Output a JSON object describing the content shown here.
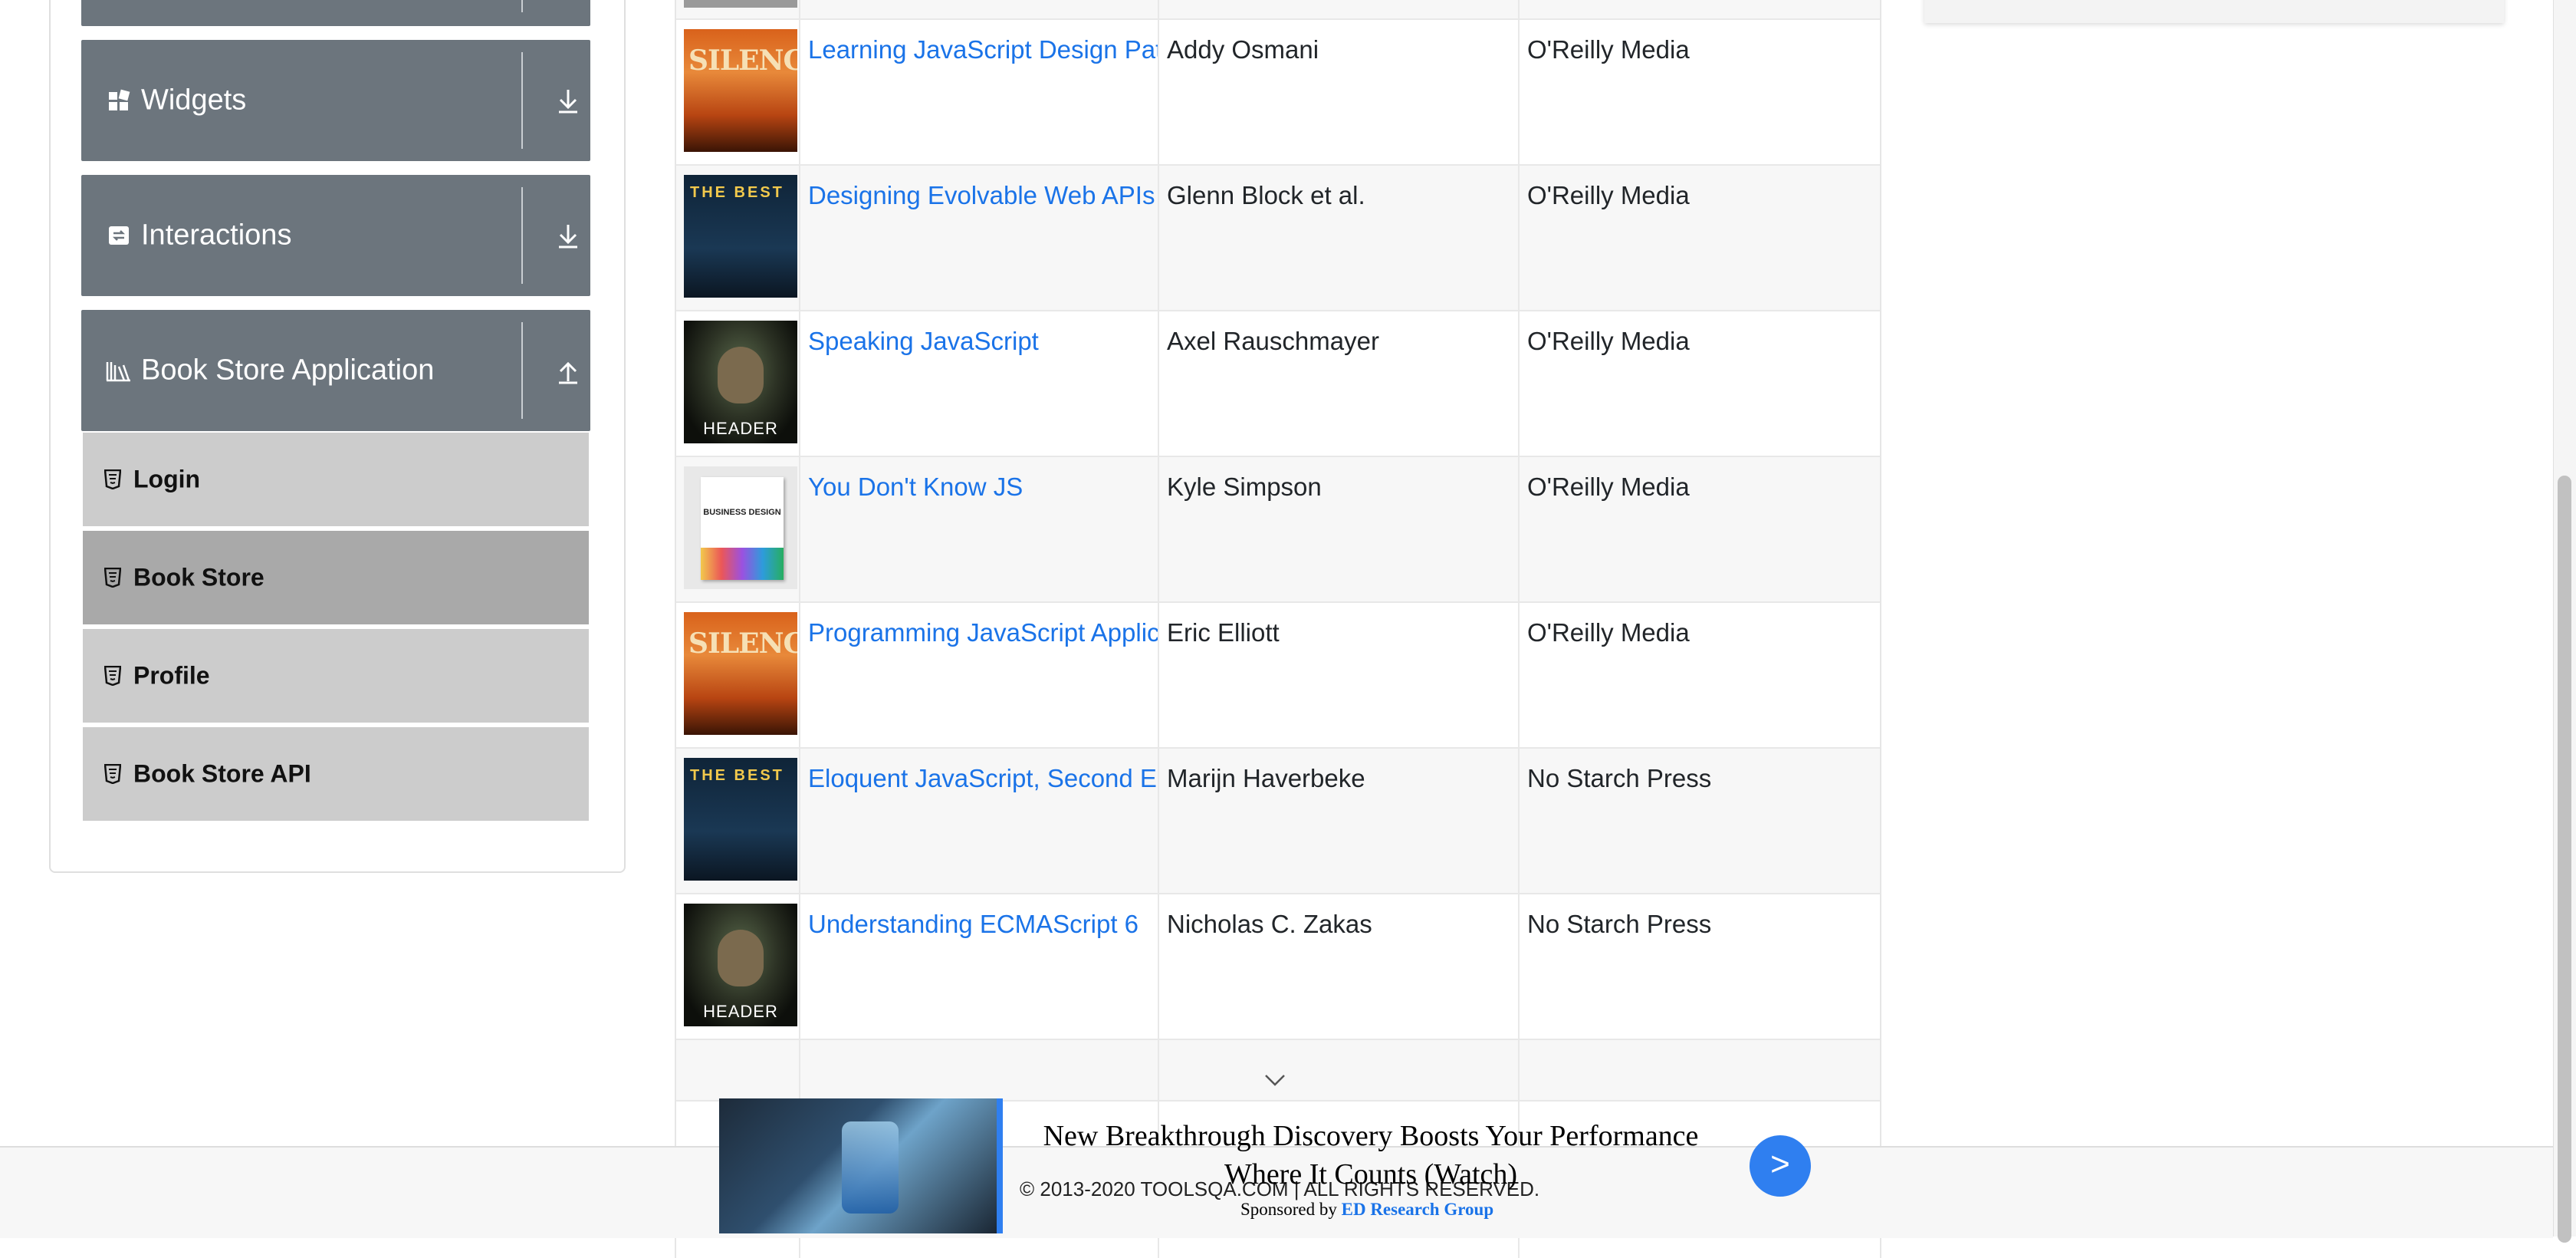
{
  "sidebar": {
    "groups": [
      {
        "label": "Widgets",
        "icon": "widgets-grid-icon",
        "arrow": "download-arrow-icon"
      },
      {
        "label": "Interactions",
        "icon": "interactions-icon",
        "arrow": "download-arrow-icon"
      },
      {
        "label": "Book Store Application",
        "icon": "library-books-icon",
        "arrow": "upload-arrow-icon"
      }
    ],
    "items": [
      {
        "label": "Login",
        "active": false
      },
      {
        "label": "Book Store",
        "active": true
      },
      {
        "label": "Profile",
        "active": false
      },
      {
        "label": "Book Store API",
        "active": false
      }
    ]
  },
  "books": [
    {
      "title": "Learning JavaScript Design Patterns",
      "author": "Addy Osmani",
      "publisher": "O'Reilly Media",
      "cover": "silence",
      "cover_text": "SILENCE"
    },
    {
      "title": "Designing Evolvable Web APIs with ASP.NET",
      "author": "Glenn Block et al.",
      "publisher": "O'Reilly Media",
      "cover": "best",
      "cover_text": "THE BEST"
    },
    {
      "title": "Speaking JavaScript",
      "author": "Axel Rauschmayer",
      "publisher": "O'Reilly Media",
      "cover": "header",
      "cover_text": "HEADER"
    },
    {
      "title": "You Don't Know JS",
      "author": "Kyle Simpson",
      "publisher": "O'Reilly Media",
      "cover": "biz",
      "cover_text": "BUSINESS DESIGN"
    },
    {
      "title": "Programming JavaScript Applications",
      "author": "Eric Elliott",
      "publisher": "O'Reilly Media",
      "cover": "silence",
      "cover_text": "SILENCE"
    },
    {
      "title": "Eloquent JavaScript, Second Edition",
      "author": "Marijn Haverbeke",
      "publisher": "No Starch Press",
      "cover": "best",
      "cover_text": "THE BEST"
    },
    {
      "title": "Understanding ECMAScript 6",
      "author": "Nicholas C. Zakas",
      "publisher": "No Starch Press",
      "cover": "header",
      "cover_text": "HEADER"
    }
  ],
  "footer": {
    "copyright": "© 2013-2020 TOOLSQA.COM | ALL RIGHTS RESERVED."
  },
  "ad": {
    "headline": "New Breakthrough Discovery Boosts Your Performance Where It Counts (Watch)",
    "sponsored_by": "Sponsored by",
    "sponsor": "ED Research Group",
    "button": ">"
  },
  "colors": {
    "group_bg": "#6c757d",
    "item_bg": "#cccccc",
    "item_active_bg": "#a9a9a9",
    "link": "#1a73e8",
    "ad_accent": "#2f7ff0"
  }
}
